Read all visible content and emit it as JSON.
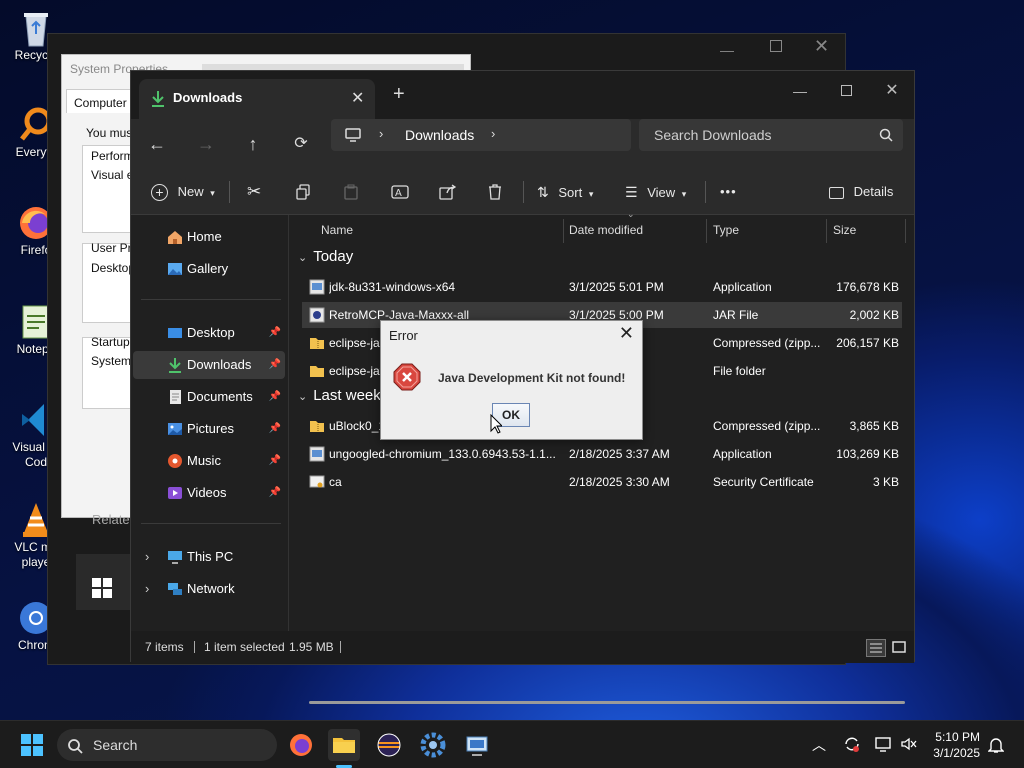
{
  "desktop": {
    "icons": [
      {
        "label": "Recycle",
        "icon": "recycle-bin-icon"
      },
      {
        "label": "Everyth",
        "icon": "everything-search-icon"
      },
      {
        "label": "Firefo",
        "icon": "firefox-icon"
      },
      {
        "label": "Notepa",
        "icon": "notepad-icon"
      },
      {
        "label": "Visual St\nCod",
        "icon": "vscode-icon"
      },
      {
        "label": "VLC me\nplaye",
        "icon": "vlc-icon"
      },
      {
        "label": "Chrom",
        "icon": "chromium-icon"
      }
    ]
  },
  "system_properties": {
    "title": "System Properties",
    "tab": "Computer N",
    "lines": [
      "You must",
      "Performa",
      "Visual ef",
      "User Pro",
      "Desktop",
      "Startup a",
      "System s",
      "Relate"
    ]
  },
  "explorer": {
    "tab_title": "Downloads",
    "breadcrumb": [
      "Downloads"
    ],
    "search_placeholder": "Search Downloads",
    "commands": {
      "new": "New",
      "sort": "Sort",
      "view": "View",
      "more": "•••",
      "details": "Details"
    },
    "nav": {
      "home": "Home",
      "gallery": "Gallery",
      "desktop": "Desktop",
      "downloads": "Downloads",
      "documents": "Documents",
      "pictures": "Pictures",
      "music": "Music",
      "videos": "Videos",
      "this_pc": "This PC",
      "network": "Network"
    },
    "columns": {
      "name": "Name",
      "date": "Date modified",
      "type": "Type",
      "size": "Size"
    },
    "groups": {
      "today": "Today",
      "last_week": "Last week"
    },
    "files": [
      {
        "name": "jdk-8u331-windows-x64",
        "date": "3/1/2025 5:01 PM",
        "type": "Application",
        "size": "176,678 KB",
        "icon": "application-icon"
      },
      {
        "name": "RetroMCP-Java-Maxxx-all",
        "date": "3/1/2025 5:00 PM",
        "type": "JAR File",
        "size": "2,002 KB",
        "icon": "jar-file-icon",
        "selected": true
      },
      {
        "name": "eclipse-jav",
        "date": "PM",
        "type": "Compressed (zipp...",
        "size": "206,157 KB",
        "icon": "zip-folder-icon"
      },
      {
        "name": "eclipse-jav",
        "date": "PM",
        "type": "File folder",
        "size": "",
        "icon": "folder-icon"
      },
      {
        "name": "uBlock0_1",
        "date": "AM",
        "type": "Compressed (zipp...",
        "size": "3,865 KB",
        "icon": "zip-folder-icon"
      },
      {
        "name": "ungoogled-chromium_133.0.6943.53-1.1...",
        "date": "2/18/2025 3:37 AM",
        "type": "Application",
        "size": "103,269 KB",
        "icon": "application-icon"
      },
      {
        "name": "ca",
        "date": "2/18/2025 3:30 AM",
        "type": "Security Certificate",
        "size": "3 KB",
        "icon": "certificate-icon"
      }
    ],
    "status": {
      "items": "7 items",
      "selected": "1 item selected",
      "size": "1.95 MB"
    }
  },
  "dialog": {
    "title": "Error",
    "message": "Java Development Kit not found!",
    "ok": "OK"
  },
  "taskbar": {
    "search": "Search",
    "time": "5:10 PM",
    "date": "3/1/2025"
  },
  "colors": {
    "accent": "#0078d4",
    "error": "#d64545",
    "selection": "#3a3a3a"
  }
}
